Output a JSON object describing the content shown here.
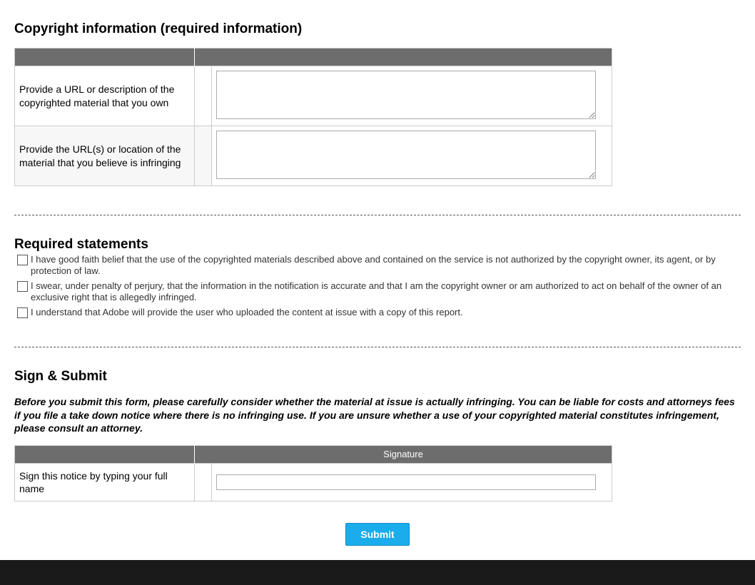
{
  "copyright_section": {
    "heading": "Copyright information (required information)",
    "header_col1": "",
    "header_col2": "",
    "rows": [
      {
        "label": "Provide a URL or description of the copyrighted material that you own",
        "value": ""
      },
      {
        "label": "Provide the URL(s) or location of the material that you believe is infringing",
        "value": ""
      }
    ]
  },
  "statements_section": {
    "heading": "Required statements",
    "items": [
      "I have good faith belief that the use of the copyrighted materials described above and contained on the service is not authorized by the copyright owner, its agent, or by protection of law.",
      "I swear, under penalty of perjury, that the information in the notification is accurate and that I am the copyright owner or am authorized to act on behalf of the owner of an exclusive right that is allegedly infringed.",
      "I understand that Adobe will provide the user who uploaded the content at issue with a copy of this report."
    ]
  },
  "sign_section": {
    "heading": "Sign & Submit",
    "warning": "Before you submit this form, please carefully consider whether the material at issue is actually infringing. You can be liable for costs and attorneys fees if you file a take down notice where there is no infringing use. If you are unsure whether a use of your copyrighted material constitutes infringement, please consult an attorney.",
    "header_col1": "",
    "header_col2": "Signature",
    "row_label": "Sign this notice by typing your full name",
    "row_value": ""
  },
  "submit_button": "Submit"
}
